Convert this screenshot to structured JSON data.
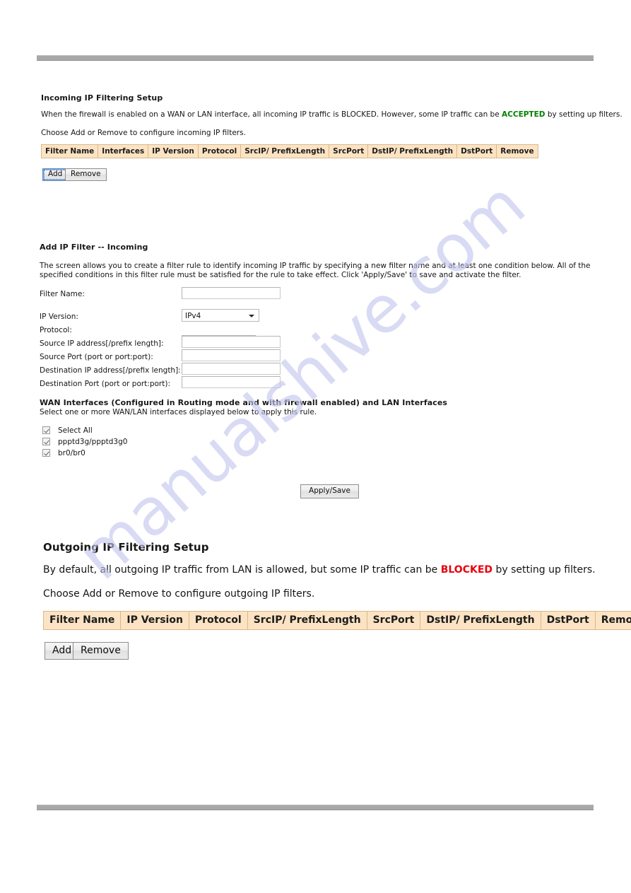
{
  "page": {
    "watermark_text": "manualshive.com",
    "rule_color": "#a8a8a8"
  },
  "incoming": {
    "heading": "Incoming IP Filtering Setup",
    "intro_prefix": "When the firewall is enabled on a WAN or LAN interface, all incoming IP traffic is BLOCKED. However, some IP traffic can be ",
    "intro_highlight": "ACCEPTED",
    "intro_suffix": " by setting up filters.",
    "highlight_color": "#008000",
    "instruction": "Choose Add or Remove to configure incoming IP filters.",
    "table": {
      "columns": [
        "Filter Name",
        "Interfaces",
        "IP Version",
        "Protocol",
        "SrcIP/ PrefixLength",
        "SrcPort",
        "DstIP/ PrefixLength",
        "DstPort",
        "Remove"
      ],
      "rows": []
    },
    "add_label": "Add",
    "remove_label": "Remove"
  },
  "add_filter": {
    "heading": "Add IP Filter -- Incoming",
    "description_line1": "The screen allows you to create a filter rule to identify incoming IP traffic by specifying a new filter name and at least one condition below. All of the",
    "description_line2": "specified conditions in this filter rule must be satisfied for the rule to take effect. Click 'Apply/Save' to save and activate the filter.",
    "fields": [
      {
        "label": "Filter Name:",
        "type": "text",
        "value": ""
      },
      {
        "label": "IP Version:",
        "type": "select",
        "value": "IPv4"
      },
      {
        "label": "Protocol:",
        "type": "select",
        "value": ""
      },
      {
        "label": "Source IP address[/prefix length]:",
        "type": "text",
        "value": ""
      },
      {
        "label": "Source Port (port or port:port):",
        "type": "text",
        "value": ""
      },
      {
        "label": "Destination IP address[/prefix length]:",
        "type": "text",
        "value": ""
      },
      {
        "label": "Destination Port (port or port:port):",
        "type": "text",
        "value": ""
      }
    ],
    "interfaces_heading": "WAN Interfaces (Configured in Routing mode and with firewall enabled) and LAN Interfaces",
    "interfaces_subtext": "Select one or more WAN/LAN interfaces displayed below to apply this rule.",
    "checkboxes": [
      {
        "label": "Select All",
        "checked": true
      },
      {
        "label": "ppptd3g/ppptd3g0",
        "checked": true
      },
      {
        "label": "br0/br0",
        "checked": true
      }
    ],
    "apply_label": "Apply/Save"
  },
  "outgoing": {
    "heading": "Outgoing IP Filtering Setup",
    "intro_prefix": "By default, all outgoing IP traffic from LAN is allowed, but some IP traffic can be ",
    "intro_highlight": "BLOCKED",
    "intro_suffix": " by setting up filters.",
    "highlight_color": "#e8000d",
    "instruction": "Choose Add or Remove to configure outgoing IP filters.",
    "table": {
      "columns": [
        "Filter Name",
        "IP Version",
        "Protocol",
        "SrcIP/ PrefixLength",
        "SrcPort",
        "DstIP/ PrefixLength",
        "DstPort",
        "Remove"
      ],
      "rows": []
    },
    "add_label": "Add",
    "remove_label": "Remove"
  }
}
